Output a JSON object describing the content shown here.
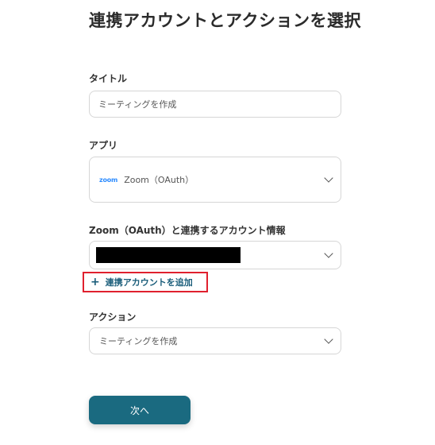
{
  "page": {
    "title": "連携アカウントとアクションを選択"
  },
  "form": {
    "title_field": {
      "label": "タイトル",
      "value": "ミーティングを作成"
    },
    "app_field": {
      "label": "アプリ",
      "logo_text": "zoom",
      "value": "Zoom（OAuth）",
      "icon": "chevron-down-icon"
    },
    "account_field": {
      "label": "Zoom（OAuth）と連携するアカウント情報",
      "value_redacted": true,
      "icon": "chevron-down-icon"
    },
    "add_account": {
      "icon": "plus-icon",
      "label": "連携アカウントを追加",
      "highlight_color": "#e0202e"
    },
    "action_field": {
      "label": "アクション",
      "value": "ミーティングを作成",
      "icon": "chevron-down-icon"
    },
    "next_button": {
      "label": "次へ",
      "color": "#1a6a80"
    }
  }
}
